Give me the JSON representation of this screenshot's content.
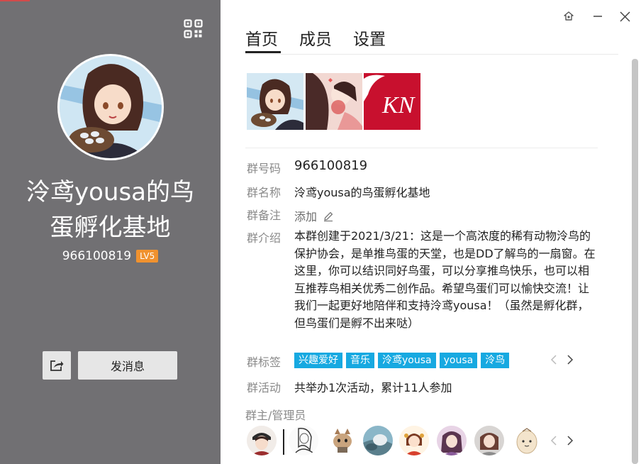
{
  "left_panel": {
    "group_name_line1": "泠鸢yousa的鸟",
    "group_name_line2": "蛋孵化基地",
    "group_number": "966100819",
    "level_badge": "LV5",
    "send_message_label": "发消息"
  },
  "tabs": [
    {
      "label": "首页"
    },
    {
      "label": "成员"
    },
    {
      "label": "设置"
    }
  ],
  "info": {
    "number_label": "群号码",
    "number_value": "966100819",
    "name_label": "群名称",
    "name_value": "泠鸢yousa的鸟蛋孵化基地",
    "remark_label": "群备注",
    "remark_value": "添加",
    "intro_label": "群介绍",
    "intro_value": "本群创建于2021/3/21：这是一个高浓度的稀有动物泠鸟的保护协会，是单推鸟蛋的天堂，也是DD了解鸟的一扇窗。在这里，你可以结识同好鸟蛋，可以分享推鸟快乐，也可以相互推荐鸟相关优秀二创作品。希望鸟蛋们可以愉快交流！让我们一起更好地陪伴和支持泠鸢yousa！（虽然是孵化群，但鸟蛋们是孵不出来哒）",
    "tags_label": "群标签",
    "tags": [
      "兴趣爱好",
      "音乐",
      "泠鸢yousa",
      "yousa",
      "泠鸟"
    ],
    "activity_label": "群活动",
    "activity_value": "共举办1次活动，累计11人参加"
  },
  "album_third_text": "KN",
  "admins_title": "群主/管理员",
  "colors": {
    "left_bg": "#717073",
    "tag_bg": "#17a9e1",
    "level_badge": "#f0922f"
  },
  "icons": [
    "qr-code-icon",
    "share-icon",
    "pin-icon",
    "minimize-icon",
    "close-icon",
    "edit-pencil-icon",
    "chevron-left-icon",
    "chevron-right-icon"
  ]
}
